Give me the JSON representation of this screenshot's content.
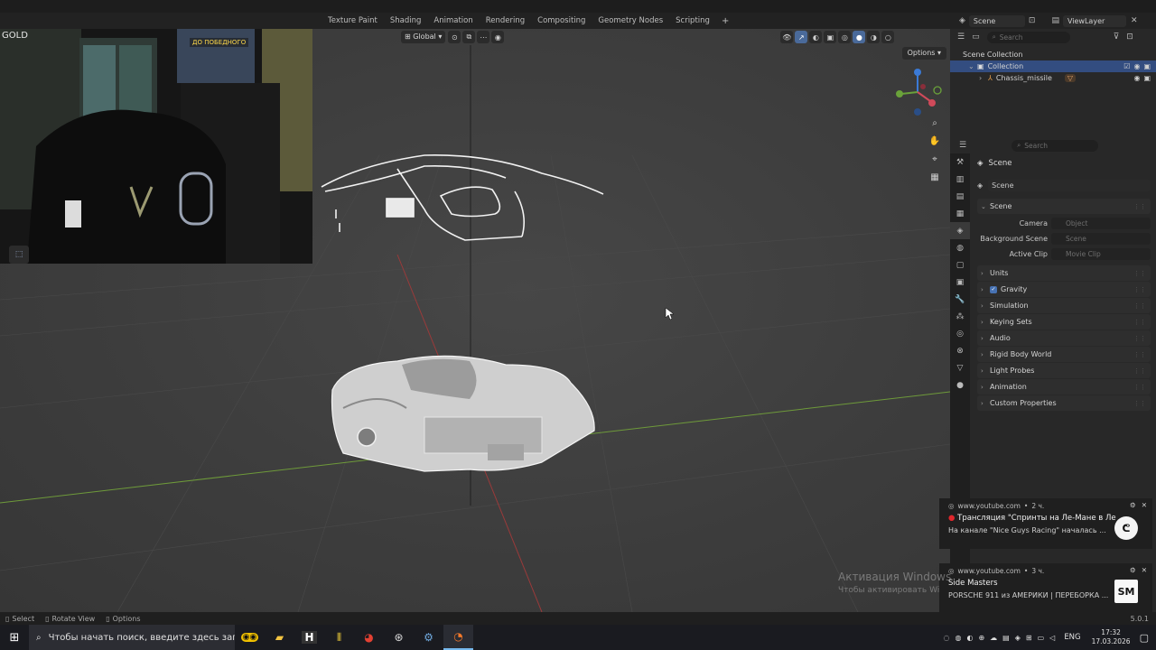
{
  "workspace_tabs": [
    "Texture Paint",
    "Shading",
    "Animation",
    "Rendering",
    "Compositing",
    "Geometry Nodes",
    "Scripting"
  ],
  "top_right": {
    "scene": "Scene",
    "view_layer": "ViewLayer"
  },
  "viewport": {
    "transform_orientation": "Global",
    "options_label": "Options"
  },
  "webcam": {
    "sign_text": "ДО ПОБЕДНОГО",
    "corner_text": "GOLD"
  },
  "outliner": {
    "search_placeholder": "Search",
    "scene_collection": "Scene Collection",
    "collection": "Collection",
    "object": "Chassis_missile"
  },
  "properties": {
    "search_placeholder": "Search",
    "context_title": "Scene",
    "datablock": "Scene",
    "panel_scene": "Scene",
    "fields": [
      {
        "label": "Camera",
        "placeholder": "Object"
      },
      {
        "label": "Background Scene",
        "placeholder": "Scene"
      },
      {
        "label": "Active Clip",
        "placeholder": "Movie Clip"
      }
    ],
    "panels": [
      "Units",
      "Gravity",
      "Simulation",
      "Keying Sets",
      "Audio",
      "Rigid Body World",
      "Light Probes",
      "Animation",
      "Custom Properties"
    ],
    "gravity_checked": true
  },
  "statusbar": {
    "select": "Select",
    "rotate": "Rotate View",
    "options": "Options",
    "version": "5.0.1"
  },
  "taskbar": {
    "search_placeholder": "Чтобы начать поиск, введите здесь запрос",
    "lang": "ENG",
    "time": "17:32",
    "date": "17.03.2026"
  },
  "notifications": [
    {
      "source": "www.youtube.com",
      "age": "2 ч.",
      "title": "Трансляция \"Спринты на Ле-Мане в Ле ...",
      "body": "На канале \"Nice Guys Racing\" началась ..."
    },
    {
      "source": "www.youtube.com",
      "age": "3 ч.",
      "title": "Side Masters",
      "body": "PORSCHE 911 из АМЕРИКИ | ПЕРЕБОРКА ..."
    }
  ],
  "watermark": {
    "line1": "Активация Windows",
    "line2": "Чтобы активировать Windows, перейдите в раздел \"Параметры\"."
  }
}
